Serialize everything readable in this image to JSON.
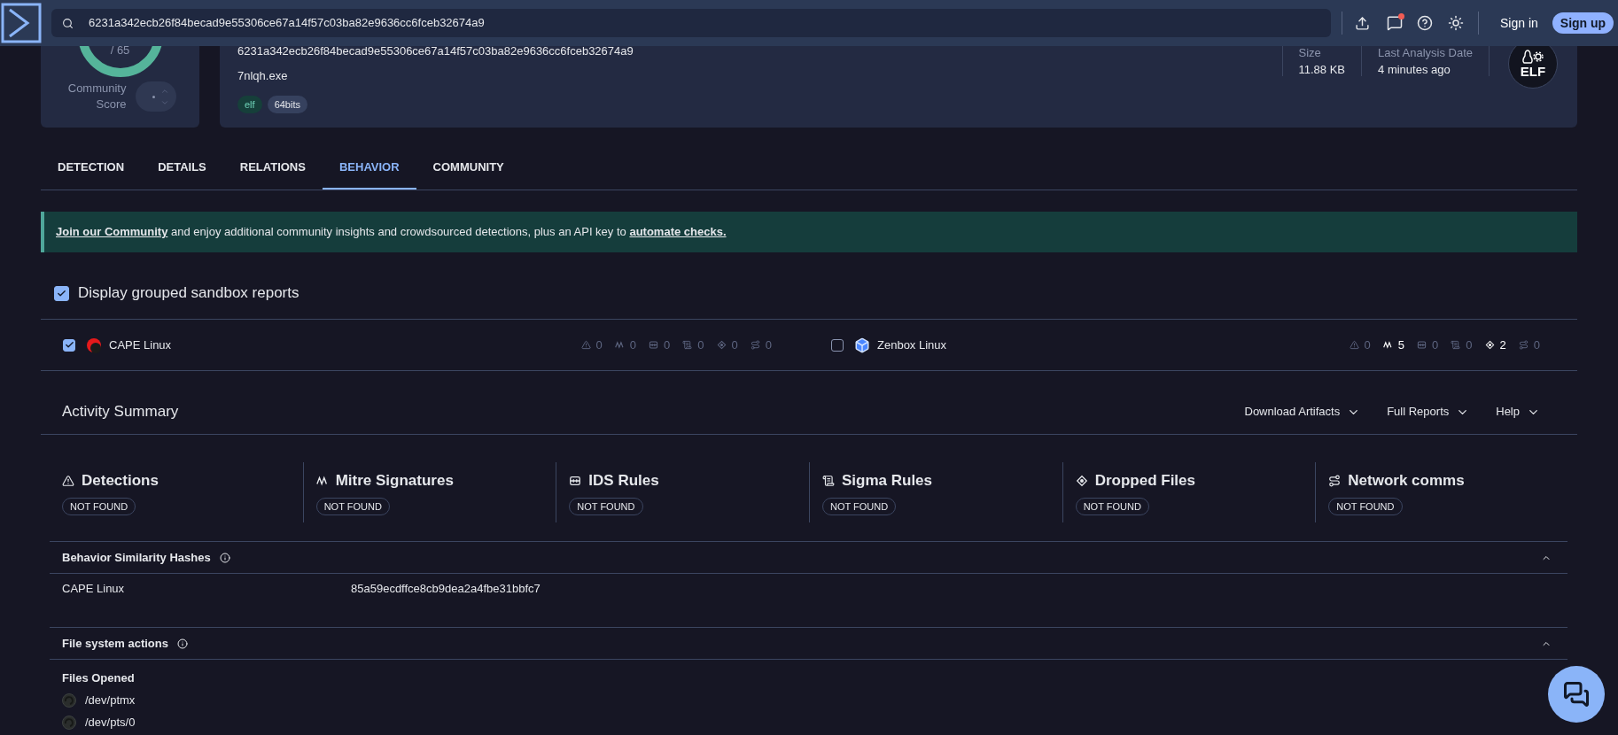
{
  "topbar": {
    "search_value": "6231a342ecb26f84becad9e55306ce67a14f57c03ba82e9636cc6fceb32674a9",
    "unread": true,
    "sign_in": "Sign in",
    "sign_up": "Sign up"
  },
  "score": {
    "total": "/ 65",
    "label": "Community Score"
  },
  "file": {
    "hash": "6231a342ecb26f84becad9e55306ce67a14f57c03ba82e9636cc6fceb32674a9",
    "name": "7nlqh.exe",
    "tags": [
      {
        "label": "elf",
        "kind": "format"
      },
      {
        "label": "64bits",
        "kind": "plain"
      }
    ],
    "stats": [
      {
        "label": "Size",
        "value": "11.88 KB"
      },
      {
        "label": "Last Analysis Date",
        "value": "4 minutes ago"
      }
    ],
    "type_badge": "ELF"
  },
  "tabs": [
    {
      "label": "DETECTION",
      "selected": false
    },
    {
      "label": "DETAILS",
      "selected": false
    },
    {
      "label": "RELATIONS",
      "selected": false
    },
    {
      "label": "BEHAVIOR",
      "selected": true
    },
    {
      "label": "COMMUNITY",
      "selected": false
    }
  ],
  "banner": {
    "parts": [
      {
        "kind": "link",
        "text": "Join our Community"
      },
      {
        "kind": "text",
        "text": " and enjoy additional community insights and crowdsourced detections, plus an API key to "
      },
      {
        "kind": "link",
        "text": "automate checks."
      }
    ]
  },
  "grouped": {
    "label": "Display grouped sandbox reports",
    "checked": true
  },
  "sandboxes": [
    {
      "name": "CAPE Linux",
      "checked": true,
      "kind": "cape",
      "stats": [
        {
          "kind": "detections",
          "value": "0",
          "active": false
        },
        {
          "kind": "mitre",
          "value": "0",
          "active": false
        },
        {
          "kind": "ids",
          "value": "0",
          "active": false
        },
        {
          "kind": "sigma",
          "value": "0",
          "active": false
        },
        {
          "kind": "dropped",
          "value": "0",
          "active": false
        },
        {
          "kind": "network",
          "value": "0",
          "active": false
        }
      ]
    },
    {
      "name": "Zenbox Linux",
      "checked": false,
      "kind": "zenbox",
      "stats": [
        {
          "kind": "detections",
          "value": "0",
          "active": false
        },
        {
          "kind": "mitre",
          "value": "5",
          "active": true
        },
        {
          "kind": "ids",
          "value": "0",
          "active": false
        },
        {
          "kind": "sigma",
          "value": "0",
          "active": false
        },
        {
          "kind": "dropped",
          "value": "2",
          "active": true
        },
        {
          "kind": "network",
          "value": "0",
          "active": false
        }
      ]
    }
  ],
  "activity": {
    "title": "Activity Summary",
    "menus": [
      "Download Artifacts",
      "Full Reports",
      "Help"
    ],
    "categories": [
      {
        "kind": "detections",
        "title": "Detections",
        "badge": "NOT FOUND"
      },
      {
        "kind": "mitre",
        "title": "Mitre Signatures",
        "badge": "NOT FOUND"
      },
      {
        "kind": "ids",
        "title": "IDS Rules",
        "badge": "NOT FOUND"
      },
      {
        "kind": "sigma",
        "title": "Sigma Rules",
        "badge": "NOT FOUND"
      },
      {
        "kind": "dropped",
        "title": "Dropped Files",
        "badge": "NOT FOUND"
      },
      {
        "kind": "network",
        "title": "Network comms",
        "badge": "NOT FOUND"
      }
    ]
  },
  "sections": [
    {
      "title": "Behavior Similarity Hashes",
      "expanded": true,
      "rows": [
        {
          "label": "CAPE Linux",
          "value": "85a59ecdffce8cb9dea2a4fbe31bbfc7"
        }
      ]
    },
    {
      "title": "File system actions",
      "expanded": true,
      "groups": [
        {
          "title": "Files Opened",
          "items": [
            "/dev/ptmx",
            "/dev/pts/0"
          ]
        }
      ]
    }
  ]
}
